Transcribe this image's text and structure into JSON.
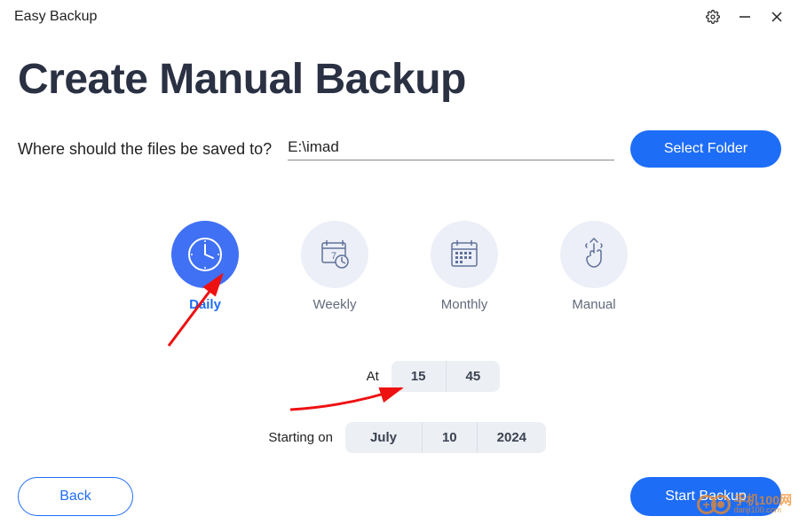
{
  "app_title": "Easy Backup",
  "page_title": "Create Manual Backup",
  "destination": {
    "label": "Where should the files be saved to?",
    "value": "E:\\imad",
    "select_button": "Select Folder"
  },
  "schedule": {
    "options": [
      {
        "key": "daily",
        "label": "Daily",
        "active": true
      },
      {
        "key": "weekly",
        "label": "Weekly",
        "active": false
      },
      {
        "key": "monthly",
        "label": "Monthly",
        "active": false
      },
      {
        "key": "manual",
        "label": "Manual",
        "active": false
      }
    ]
  },
  "time": {
    "at_label": "At",
    "hour": "15",
    "minute": "45",
    "starting_label": "Starting on",
    "month": "July",
    "day": "10",
    "year": "2024"
  },
  "footer": {
    "back": "Back",
    "start": "Start Backup"
  },
  "watermark": {
    "line1": "手机100网",
    "line2": "danji100.com"
  }
}
